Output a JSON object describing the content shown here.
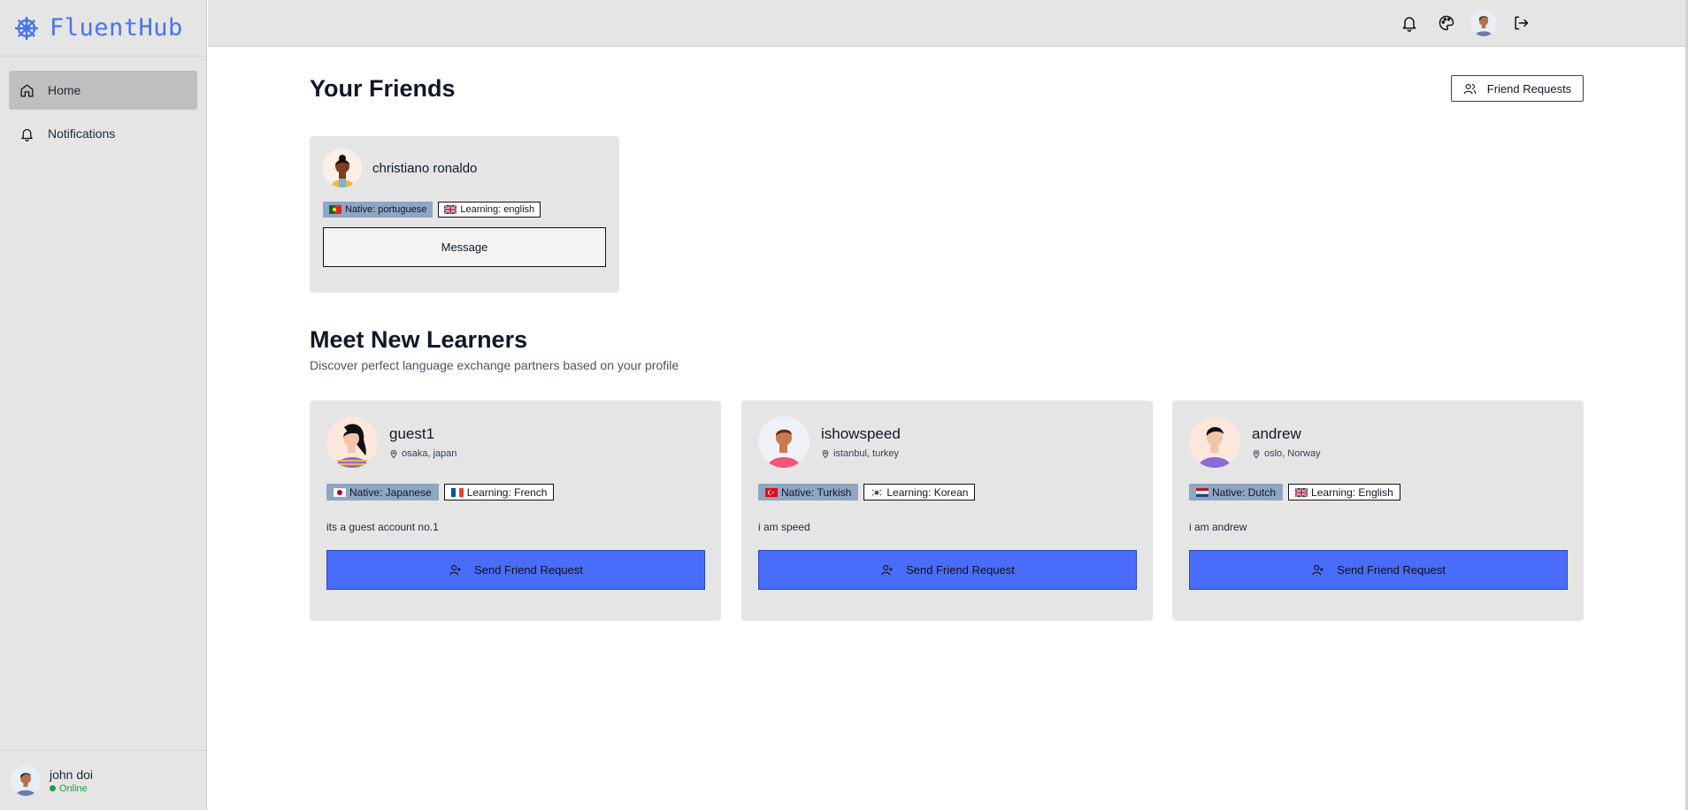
{
  "app": {
    "name": "FluentHub"
  },
  "sidebar": {
    "items": [
      {
        "label": "Home",
        "icon": "home-icon",
        "active": true
      },
      {
        "label": "Notifications",
        "icon": "bell-icon",
        "active": false
      }
    ],
    "user": {
      "name": "john doi",
      "status": "Online"
    }
  },
  "topbar": {
    "icons": [
      "bell-icon",
      "palette-icon",
      "avatar",
      "logout-icon"
    ]
  },
  "friends": {
    "title": "Your Friends",
    "requests_label": "Friend Requests",
    "list": [
      {
        "name": "christiano ronaldo",
        "native": "Native: portuguese",
        "learning": "Learning: english",
        "message_label": "Message"
      }
    ]
  },
  "learners": {
    "title": "Meet New Learners",
    "subtitle": "Discover perfect language exchange partners based on your profile",
    "send_label": "Send Friend Request",
    "list": [
      {
        "name": "guest1",
        "location": "osaka, japan",
        "native": "Native: Japanese",
        "learning": "Learning: French",
        "bio": "its a guest account no.1"
      },
      {
        "name": "ishowspeed",
        "location": "istanbul, turkey",
        "native": "Native: Turkish",
        "learning": "Learning: Korean",
        "bio": "i am speed"
      },
      {
        "name": "andrew",
        "location": "oslo, Norway",
        "native": "Native: Dutch",
        "learning": "Learning: English",
        "bio": "i am andrew"
      }
    ]
  },
  "colors": {
    "brand": "#4a73f0",
    "button": "#4a6cfa",
    "native_badge": "#8fa6c2",
    "online": "#16a34a"
  }
}
